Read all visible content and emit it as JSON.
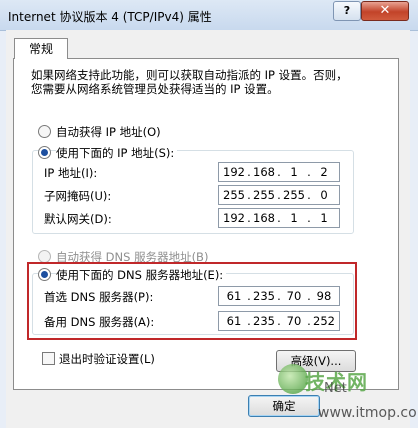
{
  "window": {
    "title": "Internet 协议版本 4 (TCP/IPv4) 属性",
    "help_label": "?",
    "close_label": "✕"
  },
  "tabs": [
    "常规"
  ],
  "intro": {
    "line1": "如果网络支持此功能，则可以获取自动指派的 IP 设置。否则，",
    "line2": "您需要从网络系统管理员处获得适当的 IP 设置。"
  },
  "ip": {
    "auto_label": "自动获得 IP 地址(O)",
    "manual_label": "使用下面的 IP 地址(S):",
    "selected": "manual",
    "fields": [
      {
        "label": "IP 地址(I):",
        "octets": [
          "192",
          "168",
          "1",
          "2"
        ]
      },
      {
        "label": "子网掩码(U):",
        "octets": [
          "255",
          "255",
          "255",
          "0"
        ]
      },
      {
        "label": "默认网关(D):",
        "octets": [
          "192",
          "168",
          "1",
          "1"
        ]
      }
    ]
  },
  "dns": {
    "auto_label": "自动获得 DNS 服务器地址(B)",
    "manual_label": "使用下面的 DNS 服务器地址(E):",
    "selected": "manual",
    "fields": [
      {
        "label": "首选 DNS 服务器(P):",
        "octets": [
          "61",
          "235",
          "70",
          "98"
        ]
      },
      {
        "label": "备用 DNS 服务器(A):",
        "octets": [
          "61",
          "235",
          "70",
          "252"
        ]
      }
    ]
  },
  "validate_label": "退出时验证设置(L)",
  "validate_checked": false,
  "advanced_label": "高级(V)...",
  "ok_label": "确定",
  "watermark": {
    "brand": "技术网",
    "domain": "Net",
    "url": "www.itmop.com"
  }
}
